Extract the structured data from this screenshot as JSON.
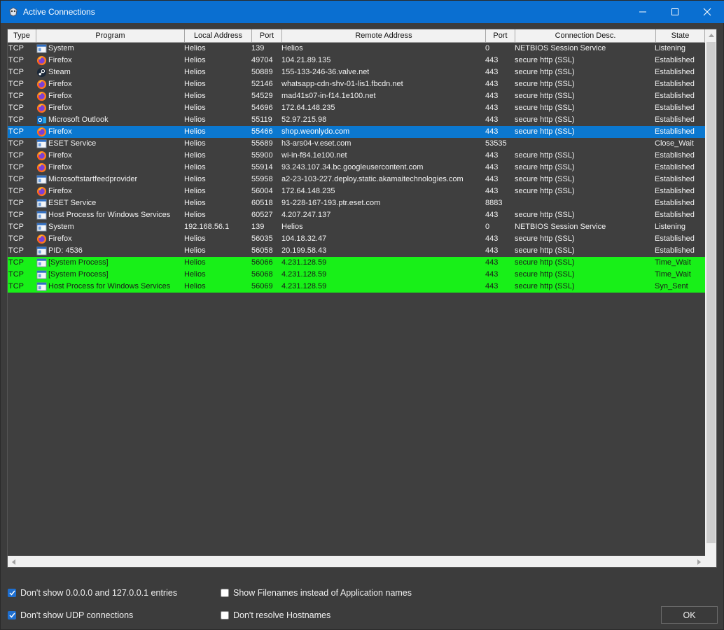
{
  "window": {
    "title": "Active Connections"
  },
  "columns": [
    {
      "label": "Type"
    },
    {
      "label": "Program"
    },
    {
      "label": "Local Address"
    },
    {
      "label": "Port"
    },
    {
      "label": "Remote Address"
    },
    {
      "label": "Port"
    },
    {
      "label": "Connection Desc."
    },
    {
      "label": "State"
    }
  ],
  "rows": [
    {
      "type": "TCP",
      "program": "System",
      "icon": "system-icon",
      "local": "Helios",
      "lport": "139",
      "remote": "Helios",
      "rport": "0",
      "desc": "NETBIOS Session Service",
      "state": "Listening",
      "highlight": "none"
    },
    {
      "type": "TCP",
      "program": "Firefox",
      "icon": "firefox-icon",
      "local": "Helios",
      "lport": "49704",
      "remote": "104.21.89.135",
      "rport": "443",
      "desc": "secure http (SSL)",
      "state": "Established",
      "highlight": "none"
    },
    {
      "type": "TCP",
      "program": "Steam",
      "icon": "steam-icon",
      "local": "Helios",
      "lport": "50889",
      "remote": "155-133-246-36.valve.net",
      "rport": "443",
      "desc": "secure http (SSL)",
      "state": "Established",
      "highlight": "none"
    },
    {
      "type": "TCP",
      "program": "Firefox",
      "icon": "firefox-icon",
      "local": "Helios",
      "lport": "52146",
      "remote": "whatsapp-cdn-shv-01-lis1.fbcdn.net",
      "rport": "443",
      "desc": "secure http (SSL)",
      "state": "Established",
      "highlight": "none"
    },
    {
      "type": "TCP",
      "program": "Firefox",
      "icon": "firefox-icon",
      "local": "Helios",
      "lport": "54529",
      "remote": "mad41s07-in-f14.1e100.net",
      "rport": "443",
      "desc": "secure http (SSL)",
      "state": "Established",
      "highlight": "none"
    },
    {
      "type": "TCP",
      "program": "Firefox",
      "icon": "firefox-icon",
      "local": "Helios",
      "lport": "54696",
      "remote": "172.64.148.235",
      "rport": "443",
      "desc": "secure http (SSL)",
      "state": "Established",
      "highlight": "none"
    },
    {
      "type": "TCP",
      "program": "Microsoft Outlook",
      "icon": "outlook-icon",
      "local": "Helios",
      "lport": "55119",
      "remote": "52.97.215.98",
      "rport": "443",
      "desc": "secure http (SSL)",
      "state": "Established",
      "highlight": "none"
    },
    {
      "type": "TCP",
      "program": "Firefox",
      "icon": "firefox-icon",
      "local": "Helios",
      "lport": "55466",
      "remote": "shop.weonlydo.com",
      "rport": "443",
      "desc": "secure http (SSL)",
      "state": "Established",
      "highlight": "selected"
    },
    {
      "type": "TCP",
      "program": "ESET Service",
      "icon": "system-icon",
      "local": "Helios",
      "lport": "55689",
      "remote": "h3-ars04-v.eset.com",
      "rport": "53535",
      "desc": "",
      "state": "Close_Wait",
      "highlight": "none"
    },
    {
      "type": "TCP",
      "program": "Firefox",
      "icon": "firefox-icon",
      "local": "Helios",
      "lport": "55900",
      "remote": "wi-in-f84.1e100.net",
      "rport": "443",
      "desc": "secure http (SSL)",
      "state": "Established",
      "highlight": "none"
    },
    {
      "type": "TCP",
      "program": "Firefox",
      "icon": "firefox-icon",
      "local": "Helios",
      "lport": "55914",
      "remote": "93.243.107.34.bc.googleusercontent.com",
      "rport": "443",
      "desc": "secure http (SSL)",
      "state": "Established",
      "highlight": "none"
    },
    {
      "type": "TCP",
      "program": "Microsoftstartfeedprovider",
      "icon": "system-icon",
      "local": "Helios",
      "lport": "55958",
      "remote": "a2-23-103-227.deploy.static.akamaitechnologies.com",
      "rport": "443",
      "desc": "secure http (SSL)",
      "state": "Established",
      "highlight": "none"
    },
    {
      "type": "TCP",
      "program": "Firefox",
      "icon": "firefox-icon",
      "local": "Helios",
      "lport": "56004",
      "remote": "172.64.148.235",
      "rport": "443",
      "desc": "secure http (SSL)",
      "state": "Established",
      "highlight": "none"
    },
    {
      "type": "TCP",
      "program": "ESET Service",
      "icon": "system-icon",
      "local": "Helios",
      "lport": "60518",
      "remote": "91-228-167-193.ptr.eset.com",
      "rport": "8883",
      "desc": "",
      "state": "Established",
      "highlight": "none"
    },
    {
      "type": "TCP",
      "program": "Host Process for Windows Services",
      "icon": "system-icon",
      "local": "Helios",
      "lport": "60527",
      "remote": "4.207.247.137",
      "rport": "443",
      "desc": "secure http (SSL)",
      "state": "Established",
      "highlight": "none"
    },
    {
      "type": "TCP",
      "program": "System",
      "icon": "system-icon",
      "local": "192.168.56.1",
      "lport": "139",
      "remote": "Helios",
      "rport": "0",
      "desc": "NETBIOS Session Service",
      "state": "Listening",
      "highlight": "none"
    },
    {
      "type": "TCP",
      "program": "Firefox",
      "icon": "firefox-icon",
      "local": "Helios",
      "lport": "56035",
      "remote": "104.18.32.47",
      "rport": "443",
      "desc": "secure http (SSL)",
      "state": "Established",
      "highlight": "none"
    },
    {
      "type": "TCP",
      "program": "PID: 4536",
      "icon": "system-icon",
      "local": "Helios",
      "lport": "56058",
      "remote": "20.199.58.43",
      "rport": "443",
      "desc": "secure http (SSL)",
      "state": "Established",
      "highlight": "none"
    },
    {
      "type": "TCP",
      "program": "[System Process]",
      "icon": "system-icon",
      "local": "Helios",
      "lport": "56066",
      "remote": "4.231.128.59",
      "rport": "443",
      "desc": "secure http (SSL)",
      "state": "Time_Wait",
      "highlight": "green"
    },
    {
      "type": "TCP",
      "program": "[System Process]",
      "icon": "system-icon",
      "local": "Helios",
      "lport": "56068",
      "remote": "4.231.128.59",
      "rport": "443",
      "desc": "secure http (SSL)",
      "state": "Time_Wait",
      "highlight": "green"
    },
    {
      "type": "TCP",
      "program": "Host Process for Windows Services",
      "icon": "system-icon",
      "local": "Helios",
      "lport": "56069",
      "remote": "4.231.128.59",
      "rport": "443",
      "desc": "secure http (SSL)",
      "state": "Syn_Sent",
      "highlight": "green"
    }
  ],
  "options": {
    "hide_local": {
      "label": "Don't show 0.0.0.0 and 127.0.0.1 entries",
      "checked": true
    },
    "hide_udp": {
      "label": "Don't show UDP connections",
      "checked": true
    },
    "show_filenames": {
      "label": "Show Filenames instead of Application names",
      "checked": false
    },
    "no_resolve": {
      "label": "Don't resolve Hostnames",
      "checked": false
    }
  },
  "ok_button": {
    "label": "OK"
  },
  "colors": {
    "titlebar": "#0a6fd1",
    "selected": "#0b78d0",
    "green": "#18f018",
    "grid_bg": "#3f3f3f"
  }
}
